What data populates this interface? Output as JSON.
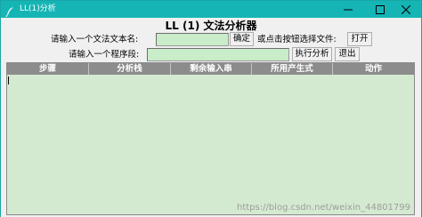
{
  "window": {
    "title": "LL(1)分析",
    "controls": {
      "minimize_icon": "minimize-icon",
      "maximize_icon": "maximize-icon",
      "close_icon": "close-icon"
    },
    "titlebar_color": "#15b5b5"
  },
  "app": {
    "heading": "LL (1) 文法分析器"
  },
  "row1": {
    "grammar_label": "请输入一个文法文本名:",
    "grammar_value": "",
    "confirm_button": "确定",
    "file_hint": "或点击按钮选择文件:",
    "open_button": "打开"
  },
  "row2": {
    "program_label": "请输入一个程序段:",
    "program_value": "",
    "run_button": "执行分析",
    "exit_button": "退出"
  },
  "table": {
    "columns": [
      "步骤",
      "分析栈",
      "剩余输入串",
      "所用产生式",
      "动作"
    ],
    "rows": [],
    "background": "#d4ead0",
    "header_background": "#8c8c8c"
  },
  "watermark": "https://blog.csdn.net/weixin_44801799"
}
